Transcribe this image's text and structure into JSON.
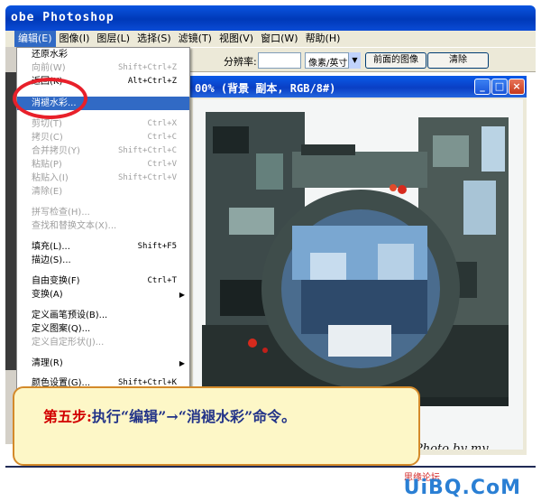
{
  "window": {
    "title": "obe Photoshop",
    "colors": {
      "titlebar": "#0039b8",
      "menu_highlight": "#316ac5",
      "annotation": "#e8202a"
    }
  },
  "menubar": {
    "items": [
      "编辑(E)",
      "图像(I)",
      "图层(L)",
      "选择(S)",
      "滤镜(T)",
      "视图(V)",
      "窗口(W)",
      "帮助(H)"
    ],
    "active_index": 0
  },
  "options": {
    "resolution_label": "分辨率:",
    "resolution_value": "",
    "unit_selected": "像素/英寸",
    "front_image_button": "前面的图像",
    "clear_button": "清除"
  },
  "document": {
    "title": "00% (背景 副本, RGB/8#)",
    "signature": "Photo by my"
  },
  "edit_menu": {
    "items": [
      {
        "label": "还原水彩",
        "shortcut": "",
        "disabled": false
      },
      {
        "label": "向前(W)",
        "shortcut": "Shift+Ctrl+Z",
        "disabled": true
      },
      {
        "label": "返回(K)",
        "shortcut": "Alt+Ctrl+Z",
        "disabled": false
      },
      {
        "label": "消褪水彩...",
        "shortcut": "",
        "disabled": false,
        "highlight": true
      },
      {
        "label": "剪切(T)",
        "shortcut": "Ctrl+X",
        "disabled": true
      },
      {
        "label": "拷贝(C)",
        "shortcut": "Ctrl+C",
        "disabled": true
      },
      {
        "label": "合并拷贝(Y)",
        "shortcut": "Shift+Ctrl+C",
        "disabled": true
      },
      {
        "label": "粘贴(P)",
        "shortcut": "Ctrl+V",
        "disabled": true
      },
      {
        "label": "粘贴入(I)",
        "shortcut": "Shift+Ctrl+V",
        "disabled": true
      },
      {
        "label": "清除(E)",
        "shortcut": "",
        "disabled": true
      },
      {
        "label": "拼写检查(H)...",
        "shortcut": "",
        "disabled": true
      },
      {
        "label": "查找和替换文本(X)...",
        "shortcut": "",
        "disabled": true
      },
      {
        "label": "填充(L)...",
        "shortcut": "Shift+F5",
        "disabled": false
      },
      {
        "label": "描边(S)...",
        "shortcut": "",
        "disabled": false
      },
      {
        "label": "自由变换(F)",
        "shortcut": "Ctrl+T",
        "disabled": false
      },
      {
        "label": "变换(A)",
        "shortcut": "",
        "disabled": false,
        "submenu": true
      },
      {
        "label": "定义画笔预设(B)...",
        "shortcut": "",
        "disabled": false
      },
      {
        "label": "定义图案(Q)...",
        "shortcut": "",
        "disabled": false
      },
      {
        "label": "定义自定形状(J)...",
        "shortcut": "",
        "disabled": true
      },
      {
        "label": "清理(R)",
        "shortcut": "",
        "disabled": false,
        "submenu": true
      },
      {
        "label": "颜色设置(G)...",
        "shortcut": "Shift+Ctrl+K",
        "disabled": false
      }
    ]
  },
  "caption": {
    "step": "第五步:",
    "text": "执行“编辑”→“消褪水彩”命令。"
  },
  "watermark": {
    "site": "UiBQ.CoM",
    "small": "思缘论坛"
  }
}
